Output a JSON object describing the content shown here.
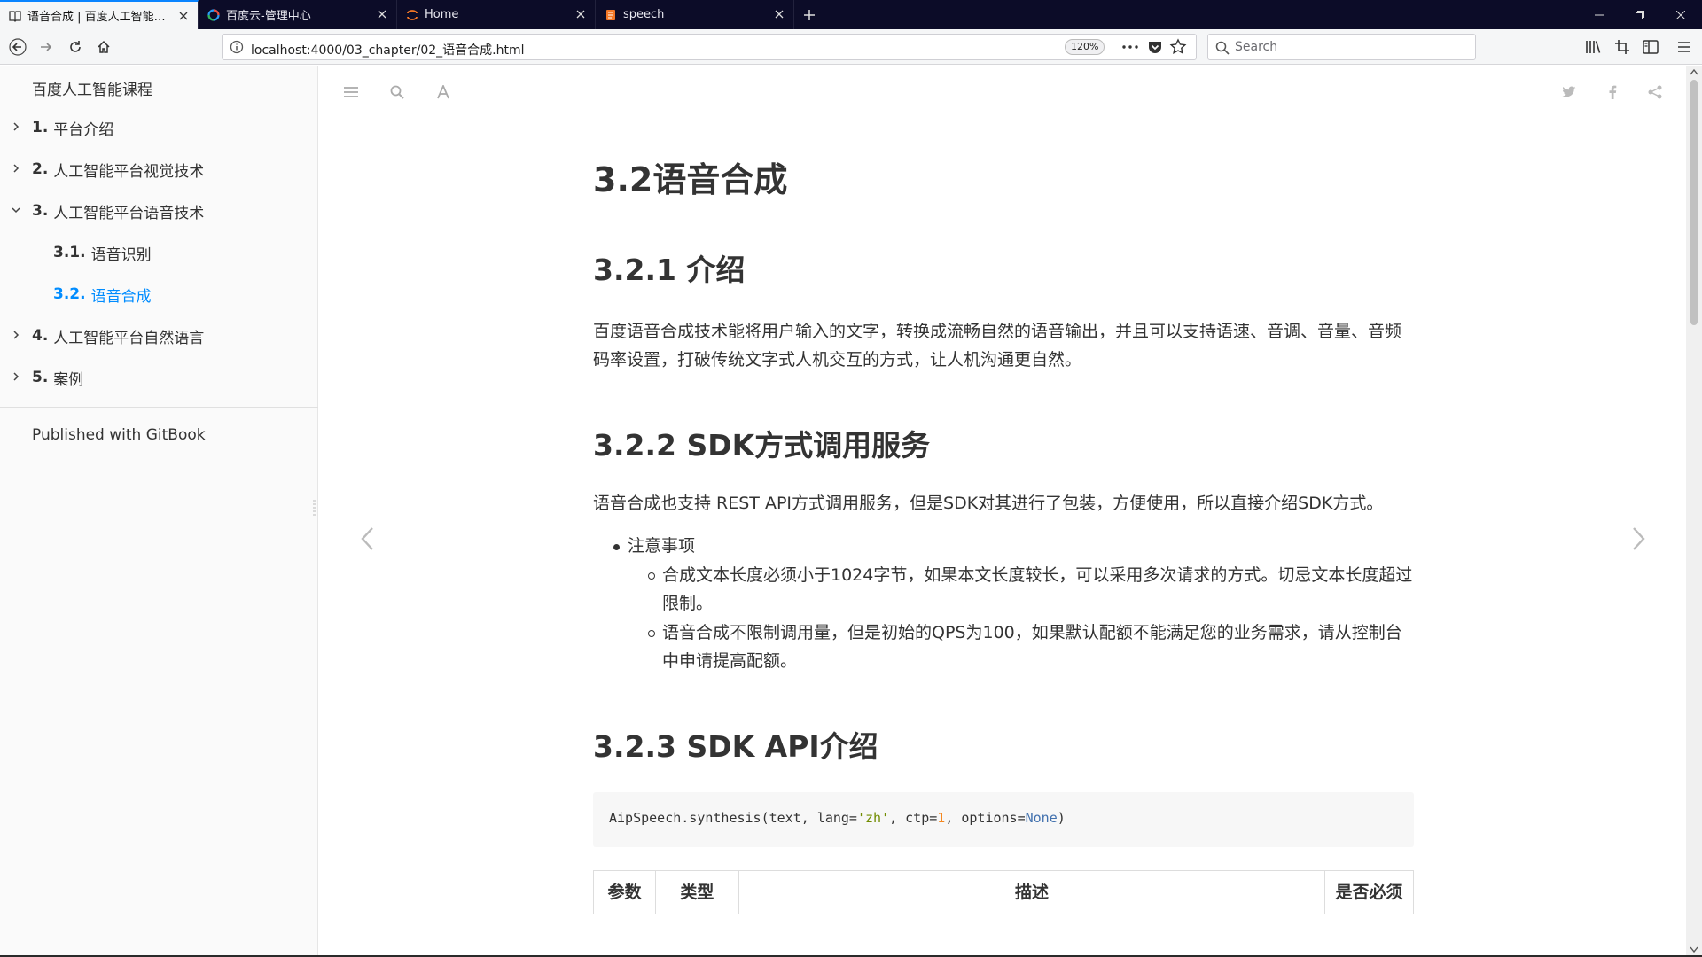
{
  "browser": {
    "tabs": [
      {
        "label": "语音合成 | 百度人工智能课程",
        "icon": "book-icon",
        "active": true
      },
      {
        "label": "百度云-管理中心",
        "icon": "baidu-cloud-icon",
        "active": false
      },
      {
        "label": "Home",
        "icon": "jupyter-icon",
        "active": false
      },
      {
        "label": "speech",
        "icon": "notebook-icon",
        "active": false
      }
    ],
    "url": "localhost:4000/03_chapter/02_语音合成.html",
    "zoom": "120%",
    "search_placeholder": "Search"
  },
  "sidebar": {
    "home_label": "百度人工智能课程",
    "items": [
      {
        "num": "1.",
        "label": "平台介绍",
        "level": 1,
        "expanded": false
      },
      {
        "num": "2.",
        "label": "人工智能平台视觉技术",
        "level": 1,
        "expanded": false
      },
      {
        "num": "3.",
        "label": "人工智能平台语音技术",
        "level": 1,
        "expanded": true
      },
      {
        "num": "3.1.",
        "label": "语音识别",
        "level": 2
      },
      {
        "num": "3.2.",
        "label": "语音合成",
        "level": 2,
        "active": true
      },
      {
        "num": "4.",
        "label": "人工智能平台自然语言",
        "level": 1,
        "expanded": false
      },
      {
        "num": "5.",
        "label": "案例",
        "level": 1,
        "expanded": false
      }
    ],
    "published": "Published with GitBook"
  },
  "content": {
    "title": "3.2语音合成",
    "sec1_heading": "3.2.1 介绍",
    "sec1_para": "百度语音合成技术能将用户输入的文字，转换成流畅自然的语音输出，并且可以支持语速、音调、音量、音频码率设置，打破传统文字式人机交互的方式，让人机沟通更自然。",
    "sec2_heading": "3.2.2 SDK方式调用服务",
    "sec2_para": "语音合成也支持 REST API方式调用服务，但是SDK对其进行了包装，方便使用，所以直接介绍SDK方式。",
    "notes_title": "注意事项",
    "note1": "合成文本长度必须小于1024字节，如果本文长度较长，可以采用多次请求的方式。切忌文本长度超过限制。",
    "note2": "语音合成不限制调用量，但是初始的QPS为100，如果默认配额不能满足您的业务需求，请从控制台中申请提高配额。",
    "sec3_heading": "3.2.3 SDK API介绍",
    "code": {
      "fn": "AipSpeech.synthesis(text, lang=",
      "lang": "'zh'",
      "mid": ", ctp=",
      "ctp": "1",
      "mid2": ", options=",
      "opt": "None",
      "end": ")"
    },
    "table_headers": [
      "参数",
      "类型",
      "描述",
      "是否必须"
    ]
  }
}
